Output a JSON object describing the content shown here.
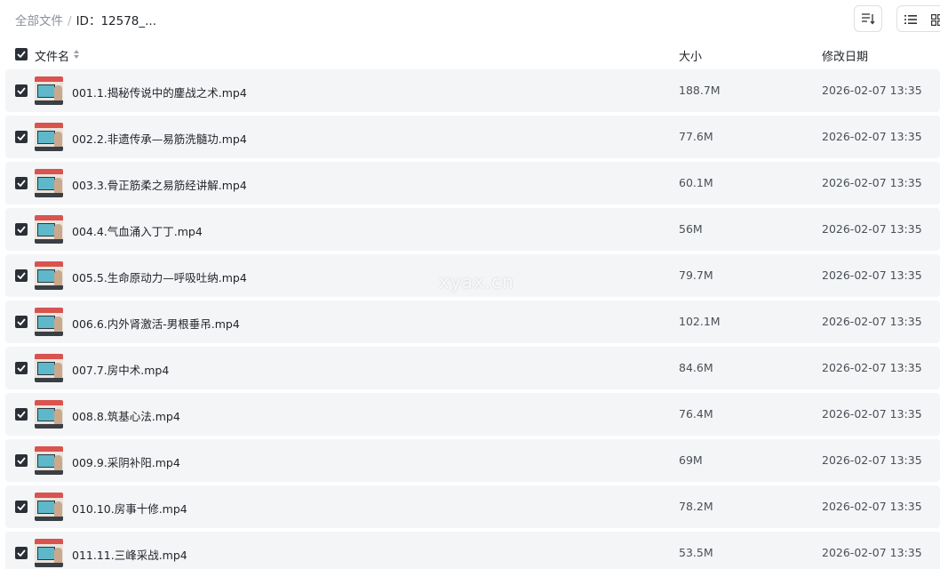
{
  "breadcrumb": {
    "root": "全部文件",
    "separator": "/",
    "current": "ID：12578_..."
  },
  "toolbar": {
    "sort_icon": "sort-icon",
    "list_view_icon": "list-view-icon",
    "grid_view_icon": "grid-view-icon"
  },
  "table": {
    "headers": {
      "name": "文件名",
      "size": "大小",
      "date": "修改日期"
    },
    "rows": [
      {
        "name": "001.1.揭秘传说中的鏖战之术.mp4",
        "size": "188.7M",
        "date": "2026-02-07 13:35",
        "checked": true
      },
      {
        "name": "002.2.非遗传承—易筋洗髓功.mp4",
        "size": "77.6M",
        "date": "2026-02-07 13:35",
        "checked": true
      },
      {
        "name": "003.3.骨正筋柔之易筋经讲解.mp4",
        "size": "60.1M",
        "date": "2026-02-07 13:35",
        "checked": true
      },
      {
        "name": "004.4.气血涌入丁丁.mp4",
        "size": "56M",
        "date": "2026-02-07 13:35",
        "checked": true
      },
      {
        "name": "005.5.生命原动力—呼吸吐纳.mp4",
        "size": "79.7M",
        "date": "2026-02-07 13:35",
        "checked": true
      },
      {
        "name": "006.6.内外肾激活-男根垂吊.mp4",
        "size": "102.1M",
        "date": "2026-02-07 13:35",
        "checked": true
      },
      {
        "name": "007.7.房中术.mp4",
        "size": "84.6M",
        "date": "2026-02-07 13:35",
        "checked": true
      },
      {
        "name": "008.8.筑基心法.mp4",
        "size": "76.4M",
        "date": "2026-02-07 13:35",
        "checked": true
      },
      {
        "name": "009.9.采阴补阳.mp4",
        "size": "69M",
        "date": "2026-02-07 13:35",
        "checked": true
      },
      {
        "name": "010.10.房事十修.mp4",
        "size": "78.2M",
        "date": "2026-02-07 13:35",
        "checked": true
      },
      {
        "name": "011.11.三峰采战.mp4",
        "size": "53.5M",
        "date": "2026-02-07 13:35",
        "checked": true
      }
    ]
  },
  "watermark": "xyax.cn",
  "colors": {
    "row_background": "#f4f5f7",
    "checkbox": "#2b2f36",
    "text": "#1f2329",
    "muted": "#8a8f99"
  }
}
